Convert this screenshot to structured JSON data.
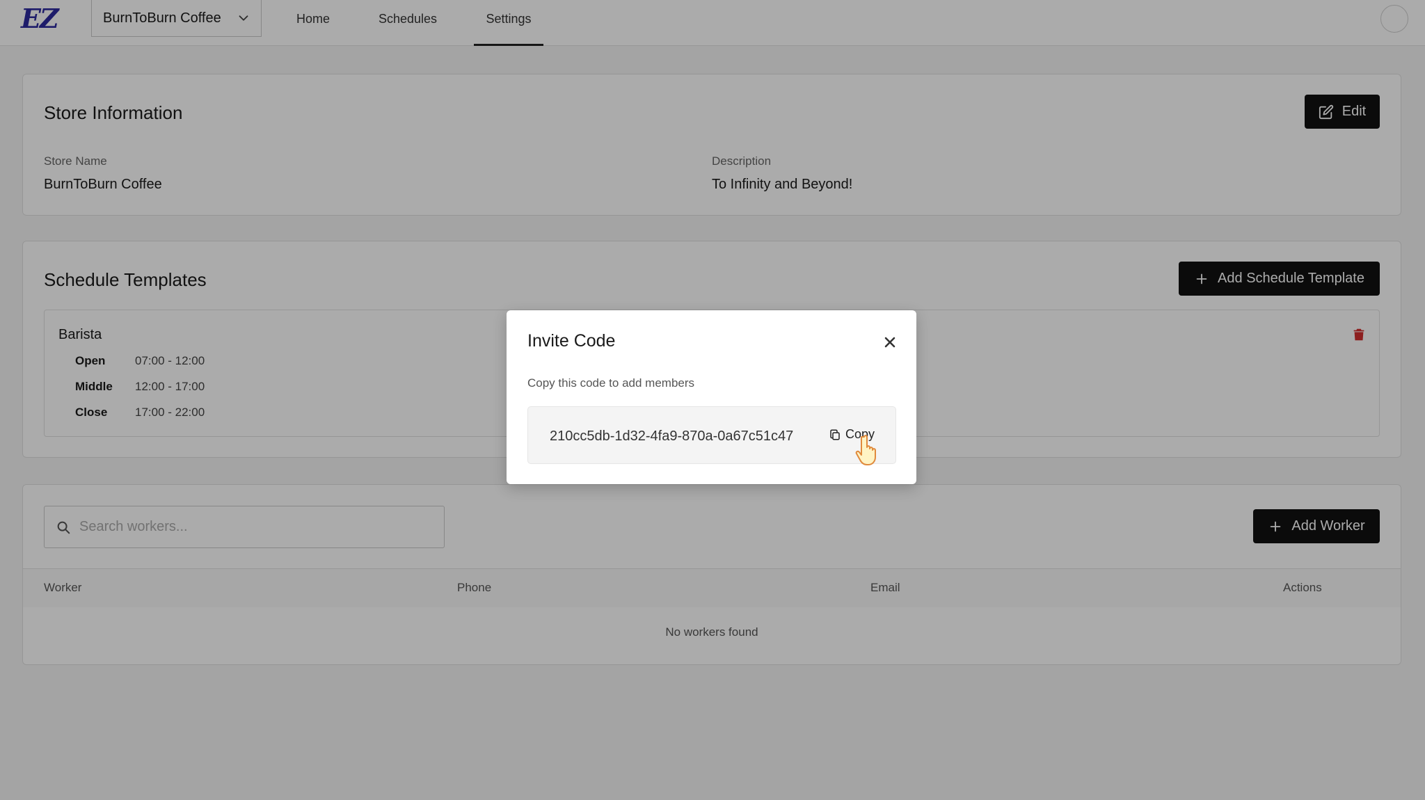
{
  "app": {
    "logo": "EZ"
  },
  "header": {
    "store_selector": "BurnToBurn Coffee",
    "tabs": [
      {
        "label": "Home"
      },
      {
        "label": "Schedules"
      },
      {
        "label": "Settings"
      }
    ],
    "active_tab": "Settings"
  },
  "store_info": {
    "title": "Store Information",
    "edit_label": "Edit",
    "store_name_label": "Store Name",
    "store_name": "BurnToBurn Coffee",
    "description_label": "Description",
    "description": "To Infinity and Beyond!"
  },
  "schedule_templates": {
    "title": "Schedule Templates",
    "add_label": "Add Schedule Template",
    "templates": [
      {
        "name": "Barista",
        "shifts": [
          {
            "name": "Open",
            "time": "07:00 - 12:00"
          },
          {
            "name": "Middle",
            "time": "12:00 - 17:00"
          },
          {
            "name": "Close",
            "time": "17:00 - 22:00"
          }
        ]
      }
    ]
  },
  "workers": {
    "search_placeholder": "Search workers...",
    "add_label": "Add Worker",
    "columns": [
      "Worker",
      "Phone",
      "Email",
      "Actions"
    ],
    "empty_text": "No workers found"
  },
  "modal": {
    "title": "Invite Code",
    "subtitle": "Copy this code to add members",
    "code": "210cc5db-1d32-4fa9-870a-0a67c51c47",
    "copy_label": "Copy"
  },
  "colors": {
    "logo": "#2d2a9e",
    "button_dark": "#111111",
    "danger": "#d32f2f"
  }
}
